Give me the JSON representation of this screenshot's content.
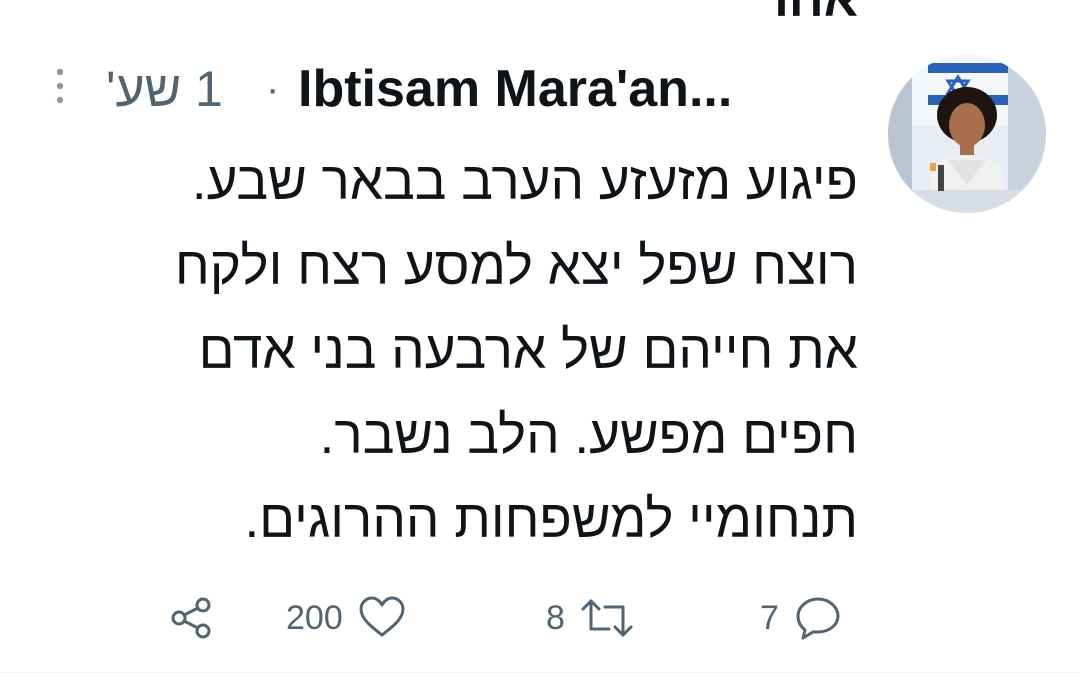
{
  "top_cutoff_text": "אחר",
  "tweet": {
    "author_name": "Ibtisam Mara'an...",
    "timestamp": "1 שע'",
    "separator": "·",
    "more_icon": "more-vertical-icon",
    "avatar": "user-avatar-photo",
    "text_lines": [
      "פיגוע מזעזע הערב בבאר שבע.",
      "רוצח שפל יצא למסע רצח ולקח",
      "את חייהם של ארבעה בני אדם",
      "חפים מפשע. הלב נשבר.",
      "תנחומיי למשפחות ההרוגים."
    ]
  },
  "actions": {
    "reply": {
      "icon": "reply-icon",
      "count": "7"
    },
    "retweet": {
      "icon": "retweet-icon",
      "count": "8"
    },
    "like": {
      "icon": "heart-icon",
      "count": "200"
    },
    "share": {
      "icon": "share-icon"
    }
  },
  "colors": {
    "text_primary": "#0f1419",
    "text_secondary": "#536471",
    "background": "#ffffff"
  }
}
